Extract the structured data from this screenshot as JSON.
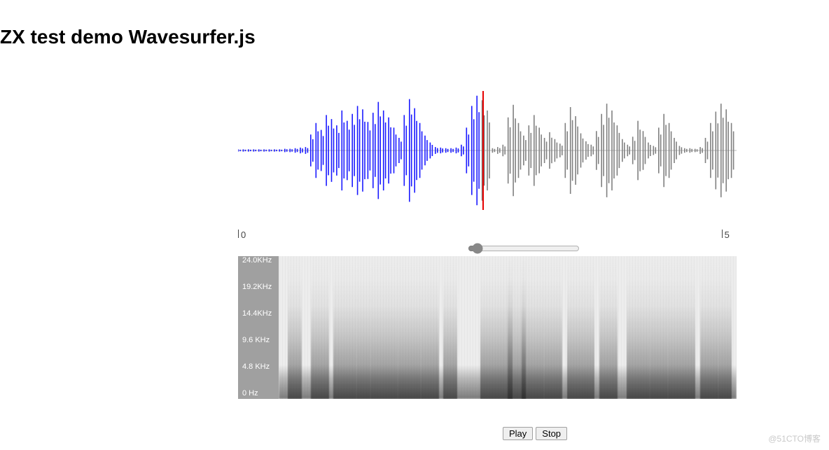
{
  "title": "ZX test demo Wavesurfer.js",
  "waveform": {
    "played_color": "#1a1aff",
    "unplayed_color": "#808080",
    "playhead_color": "#e60000",
    "playhead_position_pct": 49.0,
    "envelope": [
      0.02,
      0.02,
      0.02,
      0.02,
      0.02,
      0.02,
      0.02,
      0.02,
      0.02,
      0.03,
      0.03,
      0.04,
      0.05,
      0.06,
      0.28,
      0.48,
      0.36,
      0.62,
      0.55,
      0.44,
      0.7,
      0.52,
      0.64,
      0.78,
      0.72,
      0.5,
      0.66,
      0.85,
      0.7,
      0.58,
      0.4,
      0.22,
      0.62,
      0.9,
      0.74,
      0.48,
      0.26,
      0.14,
      0.06,
      0.05,
      0.04,
      0.04,
      0.05,
      0.1,
      0.4,
      0.78,
      0.96,
      0.88,
      0.7,
      0.04,
      0.06,
      0.1,
      0.58,
      0.8,
      0.48,
      0.26,
      0.44,
      0.62,
      0.4,
      0.22,
      0.32,
      0.2,
      0.12,
      0.48,
      0.76,
      0.6,
      0.3,
      0.16,
      0.1,
      0.34,
      0.64,
      0.82,
      0.7,
      0.44,
      0.2,
      0.1,
      0.24,
      0.52,
      0.34,
      0.14,
      0.08,
      0.4,
      0.64,
      0.48,
      0.22,
      0.08,
      0.04,
      0.04,
      0.03,
      0.06,
      0.22,
      0.48,
      0.68,
      0.82,
      0.72,
      0.48
    ]
  },
  "timeline": {
    "ticks": [
      {
        "pct": 0,
        "label": "0"
      },
      {
        "pct": 97,
        "label": "5"
      }
    ]
  },
  "zoom_slider": {
    "min": 0,
    "max": 100,
    "value": 4
  },
  "spectrogram": {
    "freq_labels": [
      "24.0KHz",
      "19.2KHz",
      "14.4KHz",
      "9.6 KHz",
      "4.8 KHz",
      "0   Hz"
    ],
    "energy_bands": [
      {
        "pct": 2,
        "w": 3
      },
      {
        "pct": 7,
        "w": 4
      },
      {
        "pct": 12,
        "w": 5
      },
      {
        "pct": 17,
        "w": 3
      },
      {
        "pct": 20,
        "w": 6
      },
      {
        "pct": 26,
        "w": 5
      },
      {
        "pct": 31,
        "w": 4
      },
      {
        "pct": 36,
        "w": 3
      },
      {
        "pct": 44,
        "w": 7
      },
      {
        "pct": 50,
        "w": 4
      },
      {
        "pct": 53,
        "w": 5
      },
      {
        "pct": 58,
        "w": 4
      },
      {
        "pct": 63,
        "w": 6
      },
      {
        "pct": 70,
        "w": 4
      },
      {
        "pct": 76,
        "w": 5
      },
      {
        "pct": 81,
        "w": 4
      },
      {
        "pct": 85,
        "w": 6
      },
      {
        "pct": 92,
        "w": 4
      },
      {
        "pct": 96,
        "w": 3
      }
    ]
  },
  "controls": {
    "play": "Play",
    "stop": "Stop"
  },
  "watermark": "@51CTO博客"
}
